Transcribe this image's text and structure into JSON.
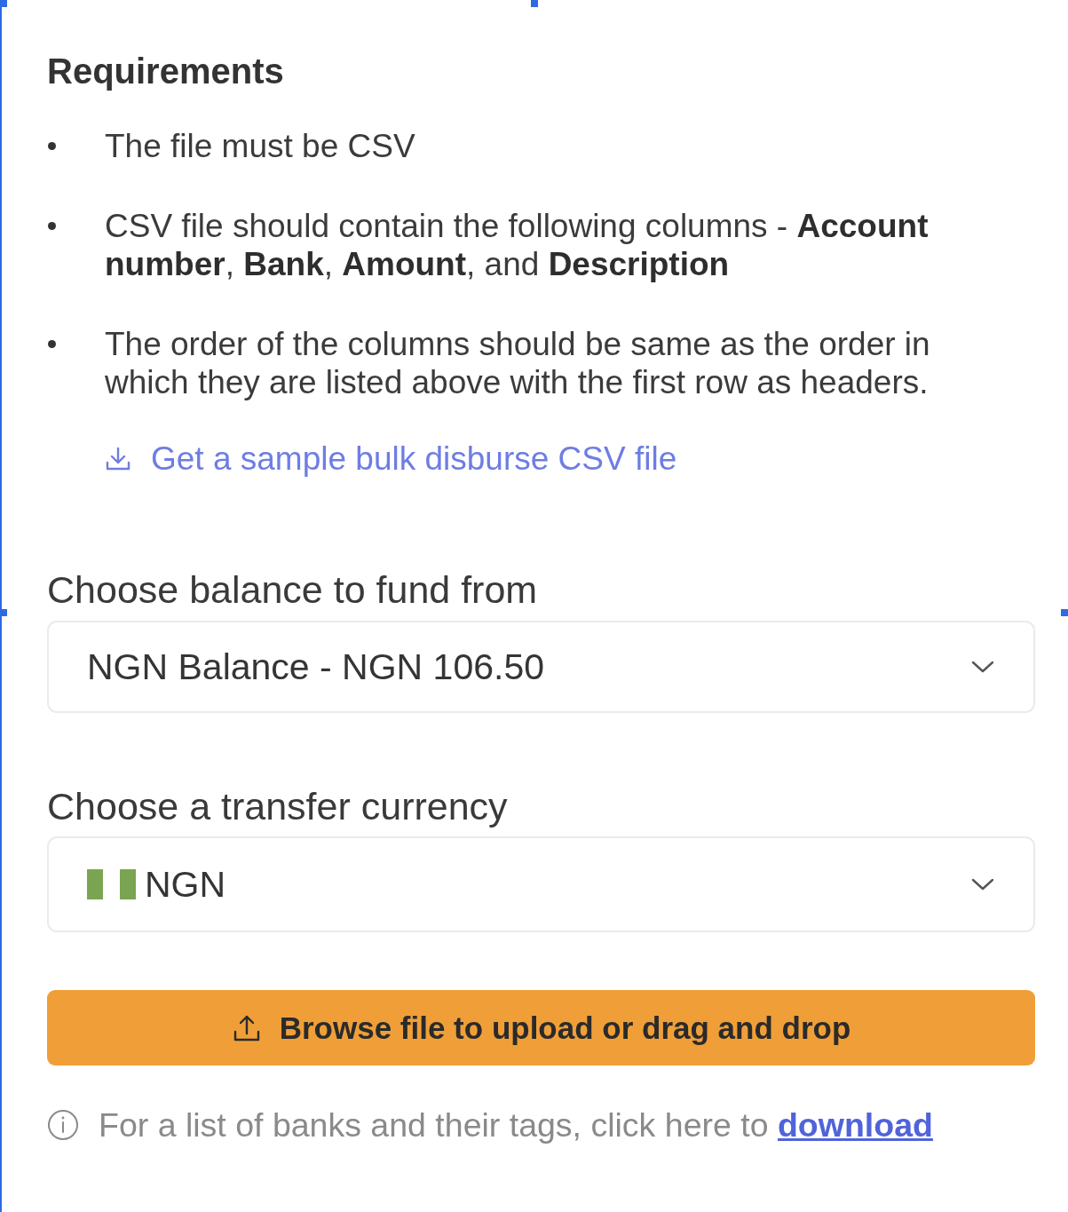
{
  "requirements": {
    "title": "Requirements",
    "items": [
      "The file must be CSV",
      "CSV file should contain the following columns - **Account number**, **Bank**, **Amount**, and **Description**",
      "The order of the columns should be same as the order in which they are listed above with the first row as headers."
    ],
    "sample_link": "Get a sample bulk disburse CSV file"
  },
  "balance_select": {
    "label": "Choose balance to fund from",
    "value": "NGN Balance - NGN 106.50"
  },
  "currency_select": {
    "label": "Choose a transfer currency",
    "value": "NGN"
  },
  "upload_button": "Browse file to upload or drag and drop",
  "info": {
    "text": "For a list of banks and their tags, click here to",
    "link": "download"
  }
}
